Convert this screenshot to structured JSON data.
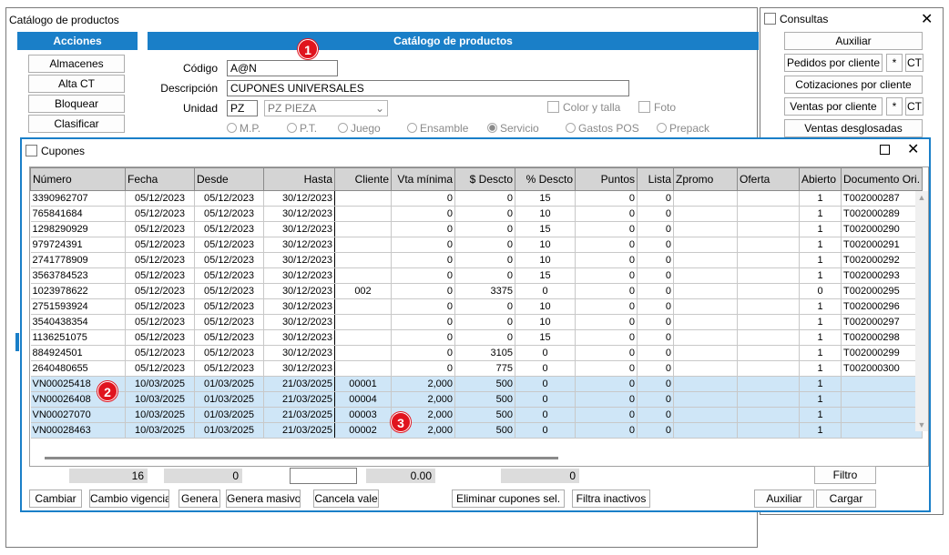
{
  "main_window": {
    "title": "Catálogo de productos",
    "acciones_header": "Acciones",
    "catalogo_header": "Catálogo de productos",
    "acciones": [
      "Almacenes",
      "Alta CT",
      "Bloquear",
      "Clasificar"
    ],
    "form": {
      "codigo_label": "Código",
      "codigo_value": "A@N",
      "descripcion_label": "Descripción",
      "descripcion_value": "CUPONES UNIVERSALES",
      "unidad_label": "Unidad",
      "unidad_code": "PZ",
      "unidad_select": "PZ  PIEZA",
      "color_talla": "Color y talla",
      "foto": "Foto",
      "tipos": [
        "M.P.",
        "P.T.",
        "Juego",
        "Ensamble",
        "Servicio",
        "Gastos POS",
        "Prepack"
      ],
      "tipo_selected": "Servicio"
    }
  },
  "consultas": {
    "title": "Consultas",
    "buttons": {
      "auxiliar": "Auxiliar",
      "pedidos": "Pedidos por cliente",
      "cotizaciones": "Cotizaciones por cliente",
      "ventas": "Ventas por cliente",
      "desglosadas": "Ventas desglosadas",
      "star": "*",
      "ct": "CT"
    }
  },
  "cupones": {
    "title": "Cupones",
    "columns": [
      "Número",
      "Fecha",
      "Desde",
      "Hasta",
      "Cliente",
      "Vta mínima",
      "$ Descto",
      "% Descto",
      "Puntos",
      "Lista",
      "Zpromo",
      "Oferta",
      "Abierto",
      "Documento Ori."
    ],
    "rows": [
      [
        "3390962707",
        "05/12/2023",
        "05/12/2023",
        "30/12/2023",
        "",
        "0",
        "0",
        "15",
        "0",
        "0",
        "",
        "",
        "1",
        "T002000287"
      ],
      [
        "765841684",
        "05/12/2023",
        "05/12/2023",
        "30/12/2023",
        "",
        "0",
        "0",
        "10",
        "0",
        "0",
        "",
        "",
        "1",
        "T002000289"
      ],
      [
        "1298290929",
        "05/12/2023",
        "05/12/2023",
        "30/12/2023",
        "",
        "0",
        "0",
        "15",
        "0",
        "0",
        "",
        "",
        "1",
        "T002000290"
      ],
      [
        "979724391",
        "05/12/2023",
        "05/12/2023",
        "30/12/2023",
        "",
        "0",
        "0",
        "10",
        "0",
        "0",
        "",
        "",
        "1",
        "T002000291"
      ],
      [
        "2741778909",
        "05/12/2023",
        "05/12/2023",
        "30/12/2023",
        "",
        "0",
        "0",
        "10",
        "0",
        "0",
        "",
        "",
        "1",
        "T002000292"
      ],
      [
        "3563784523",
        "05/12/2023",
        "05/12/2023",
        "30/12/2023",
        "",
        "0",
        "0",
        "15",
        "0",
        "0",
        "",
        "",
        "1",
        "T002000293"
      ],
      [
        "1023978622",
        "05/12/2023",
        "05/12/2023",
        "30/12/2023",
        "002",
        "0",
        "3375",
        "0",
        "0",
        "0",
        "",
        "",
        "0",
        "T002000295"
      ],
      [
        "2751593924",
        "05/12/2023",
        "05/12/2023",
        "30/12/2023",
        "",
        "0",
        "0",
        "10",
        "0",
        "0",
        "",
        "",
        "1",
        "T002000296"
      ],
      [
        "3540438354",
        "05/12/2023",
        "05/12/2023",
        "30/12/2023",
        "",
        "0",
        "0",
        "10",
        "0",
        "0",
        "",
        "",
        "1",
        "T002000297"
      ],
      [
        "1136251075",
        "05/12/2023",
        "05/12/2023",
        "30/12/2023",
        "",
        "0",
        "0",
        "15",
        "0",
        "0",
        "",
        "",
        "1",
        "T002000298"
      ],
      [
        "884924501",
        "05/12/2023",
        "05/12/2023",
        "30/12/2023",
        "",
        "0",
        "3105",
        "0",
        "0",
        "0",
        "",
        "",
        "1",
        "T002000299"
      ],
      [
        "2640480655",
        "05/12/2023",
        "05/12/2023",
        "30/12/2023",
        "",
        "0",
        "775",
        "0",
        "0",
        "0",
        "",
        "",
        "1",
        "T002000300"
      ],
      [
        "VN00025418",
        "10/03/2025",
        "01/03/2025",
        "21/03/2025",
        "00001",
        "2,000",
        "500",
        "0",
        "0",
        "0",
        "",
        "",
        "1",
        ""
      ],
      [
        "VN00026408",
        "10/03/2025",
        "01/03/2025",
        "21/03/2025",
        "00004",
        "2,000",
        "500",
        "0",
        "0",
        "0",
        "",
        "",
        "1",
        ""
      ],
      [
        "VN00027070",
        "10/03/2025",
        "01/03/2025",
        "21/03/2025",
        "00003",
        "2,000",
        "500",
        "0",
        "0",
        "0",
        "",
        "",
        "1",
        ""
      ],
      [
        "VN00028463",
        "10/03/2025",
        "01/03/2025",
        "21/03/2025",
        "00002",
        "2,000",
        "500",
        "0",
        "0",
        "0",
        "",
        "",
        "1",
        ""
      ]
    ],
    "highlighted_from": 12,
    "summary": {
      "count": "16",
      "v2": "0",
      "v3": "0.00",
      "v4": "0"
    },
    "buttons": {
      "filtro": "Filtro",
      "cambiar": "Cambiar",
      "cambio_vigencia": "Cambio vigencia",
      "genera": "Genera",
      "genera_masivo": "Genera masivo",
      "cancela_vale": "Cancela vale",
      "eliminar": "Eliminar cupones sel.",
      "filtra_inactivos": "Filtra inactivos",
      "auxiliar": "Auxiliar",
      "cargar": "Cargar"
    }
  },
  "badges": [
    "1",
    "2",
    "3"
  ],
  "colors": {
    "accent": "#1a7fc8",
    "highlight_row": "#cfe6f7",
    "badge": "#e0141e"
  }
}
